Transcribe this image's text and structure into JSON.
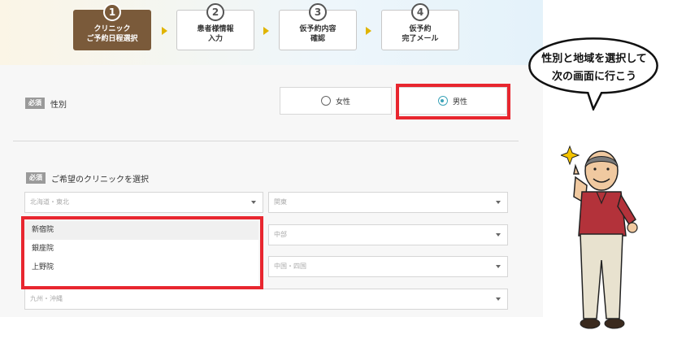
{
  "steps": [
    {
      "number": "1",
      "label": "クリニック\nご予約日程選択",
      "active": true
    },
    {
      "number": "2",
      "label": "患者様情報\n入力",
      "active": false
    },
    {
      "number": "3",
      "label": "仮予約内容\n確認",
      "active": false
    },
    {
      "number": "4",
      "label": "仮予約\n完了メール",
      "active": false
    }
  ],
  "gender": {
    "required_badge": "必須",
    "label": "性別",
    "options": [
      "女性",
      "男性"
    ],
    "selected": "男性"
  },
  "clinic": {
    "required_badge": "必須",
    "label": "ご希望のクリニックを選択",
    "regions": [
      "北海道・東北",
      "関東",
      "中部",
      "中国・四国",
      "九州・沖縄"
    ],
    "dropdown_items": [
      "新宿院",
      "銀座院",
      "上野院"
    ]
  },
  "bubble_text": "性別と地域を選択して\n次の画面に行こう",
  "colors": {
    "accent": "#7a5a3a",
    "highlight": "#e8262f",
    "radio": "#3aa3b8",
    "arrow": "#e0b400"
  }
}
